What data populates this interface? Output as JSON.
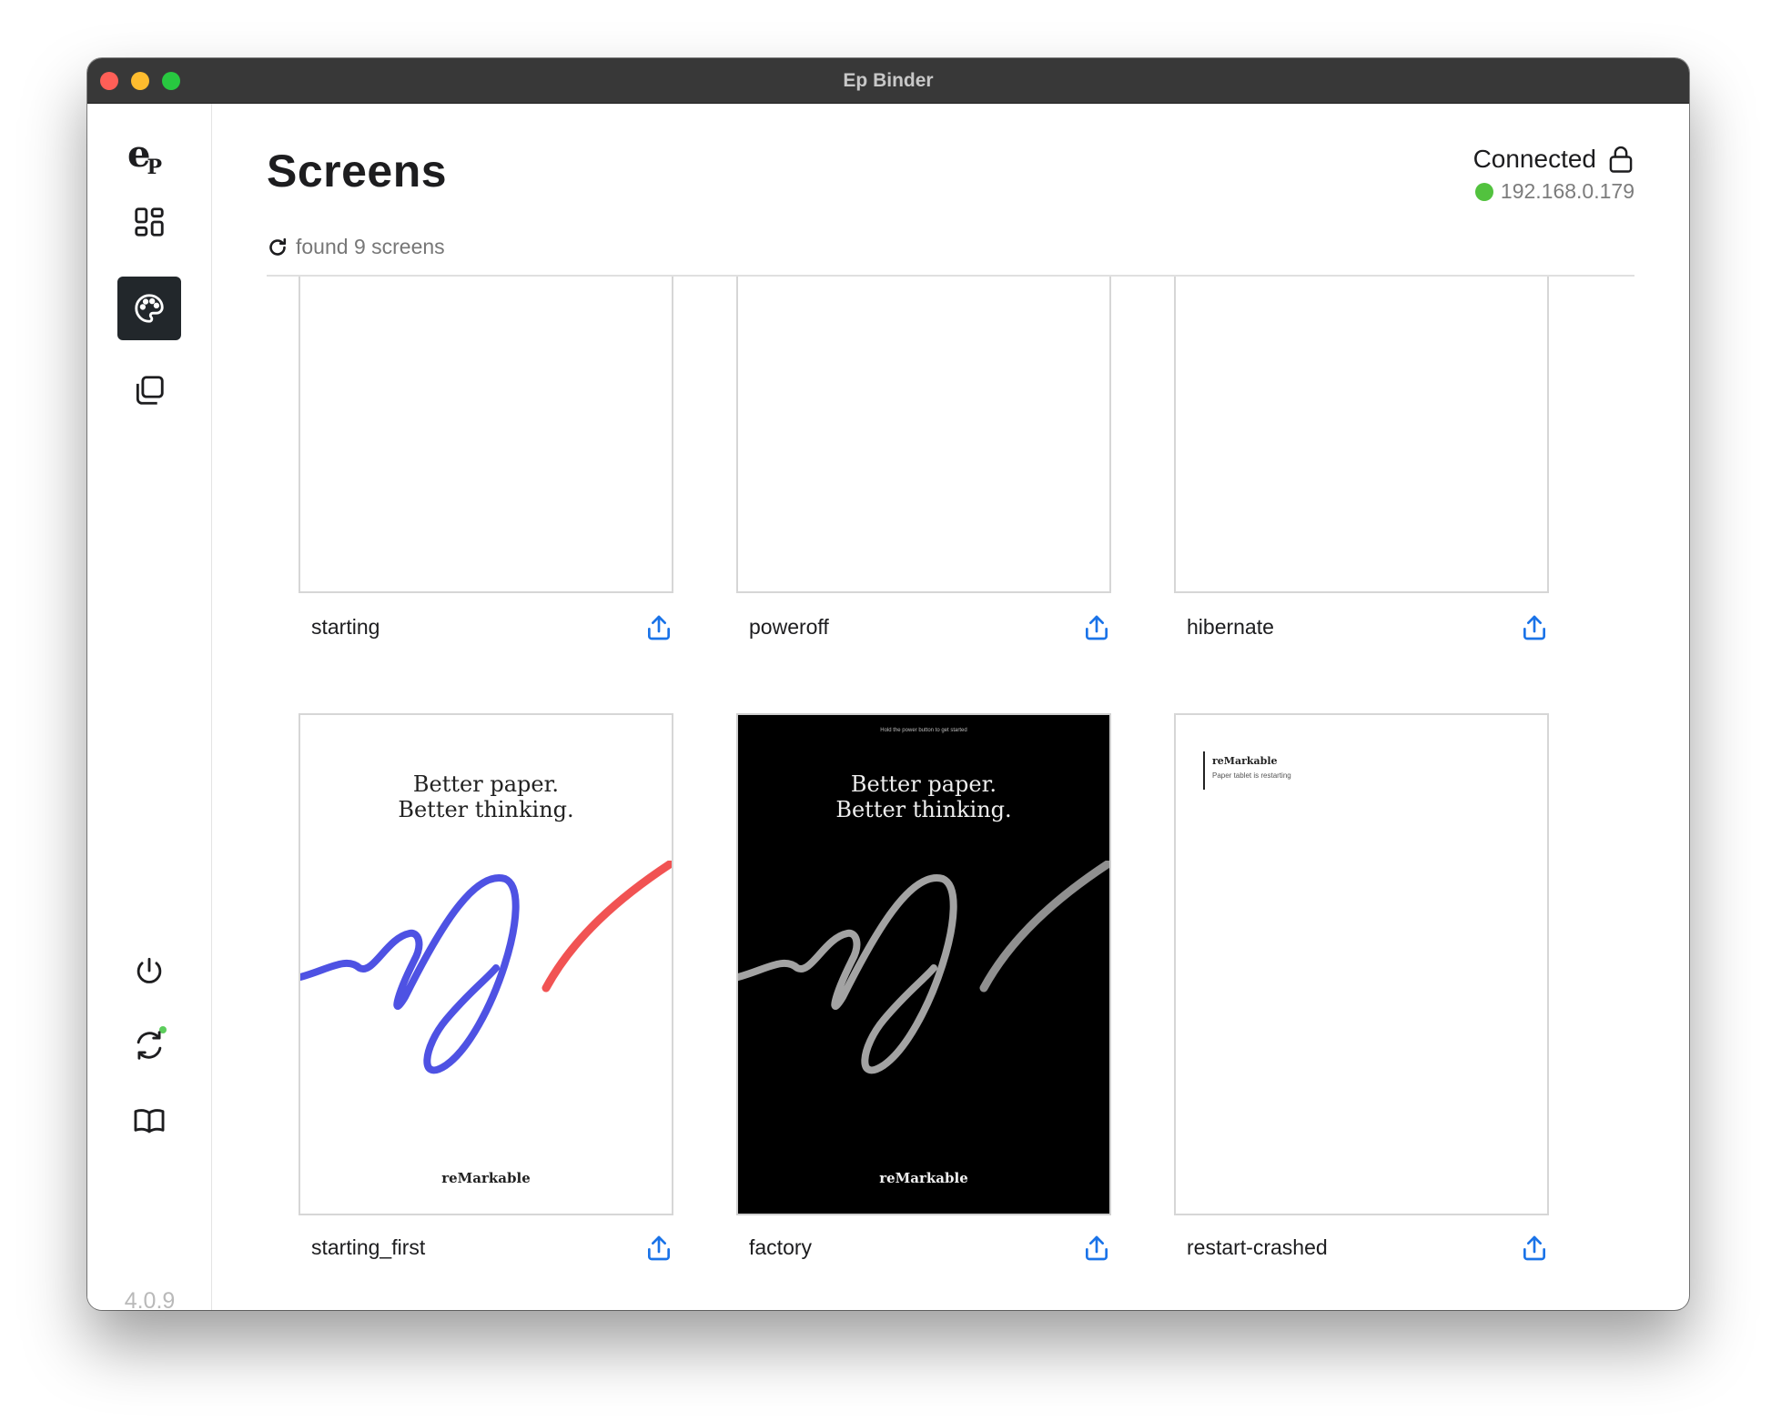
{
  "window": {
    "title": "Ep Binder"
  },
  "sidebar": {
    "logo": {
      "letter": "e",
      "sub": "P"
    },
    "items": [
      {
        "name": "dashboard",
        "icon": "grid-icon",
        "active": false
      },
      {
        "name": "screens",
        "icon": "palette-icon",
        "active": true
      },
      {
        "name": "templates",
        "icon": "copy-icon",
        "active": false
      }
    ],
    "bottom": [
      {
        "name": "power",
        "icon": "power-icon"
      },
      {
        "name": "sync",
        "icon": "refresh-icon"
      },
      {
        "name": "docs",
        "icon": "book-icon"
      }
    ],
    "version": "4.0.9"
  },
  "header": {
    "title": "Screens",
    "status_label": "Connected",
    "ip": "192.168.0.179",
    "status_color": "#52c23e",
    "found_text": "found 9 screens"
  },
  "screens": [
    {
      "name": "starting",
      "preview": "blank"
    },
    {
      "name": "poweroff",
      "preview": "blank"
    },
    {
      "name": "hibernate",
      "preview": "blank"
    },
    {
      "name": "starting_first",
      "preview": "poster-light"
    },
    {
      "name": "factory",
      "preview": "poster-dark"
    },
    {
      "name": "restart-crashed",
      "preview": "restart"
    }
  ],
  "posters": {
    "light": {
      "line1": "Better paper.",
      "line2": "Better thinking.",
      "brand": "reMarkable"
    },
    "dark": {
      "hint": "Hold the power button to get started",
      "line1": "Better paper.",
      "line2": "Better thinking.",
      "brand": "reMarkable"
    },
    "restart": {
      "brand": "reMarkable",
      "sub": "Paper tablet is restarting"
    }
  },
  "colors": {
    "accent": "#1a73e8",
    "active_bg": "#22272b",
    "stroke_blue": "#3b3fe0",
    "stroke_red": "#f04040"
  }
}
